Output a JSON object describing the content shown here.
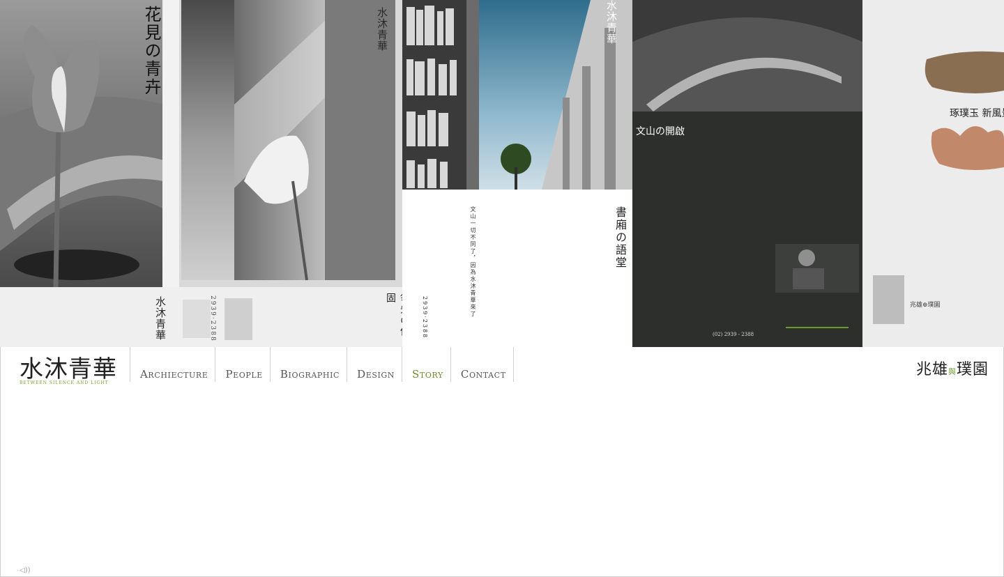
{
  "gallery": {
    "panel1": {
      "title": "花見の青卉",
      "subtitle": "領先の保固",
      "logo": "水沐青華",
      "phone": "2939·2388"
    },
    "panel2": {
      "title": "書廂の語堂",
      "headline": "文山一切不同了，因為水沐青華來了",
      "logo": "水沐青華",
      "phone": "2939·2388"
    },
    "panel3": {
      "title": "文山の開啟",
      "logo": "水沐青華",
      "phone": "(02) 2939 - 2388"
    },
    "panel4": {
      "title": "琢璞玉 新風景",
      "footer": "兆雄⊕璞園"
    }
  },
  "brand": {
    "name": "水沐青華",
    "tagline": "BETWEEN SILENCE AND LIGHT"
  },
  "nav": {
    "items": [
      {
        "label": "Archiecture"
      },
      {
        "label": "People"
      },
      {
        "label": "Biographic"
      },
      {
        "label": "Design"
      },
      {
        "label": "Story"
      },
      {
        "label": "Contact"
      }
    ],
    "active_color": "#6a8a2a"
  },
  "partner": {
    "name_a": "兆雄",
    "joiner": "與",
    "name_b": "璞園"
  },
  "sound": {
    "icon": "speaker-icon",
    "label": "◁))"
  }
}
